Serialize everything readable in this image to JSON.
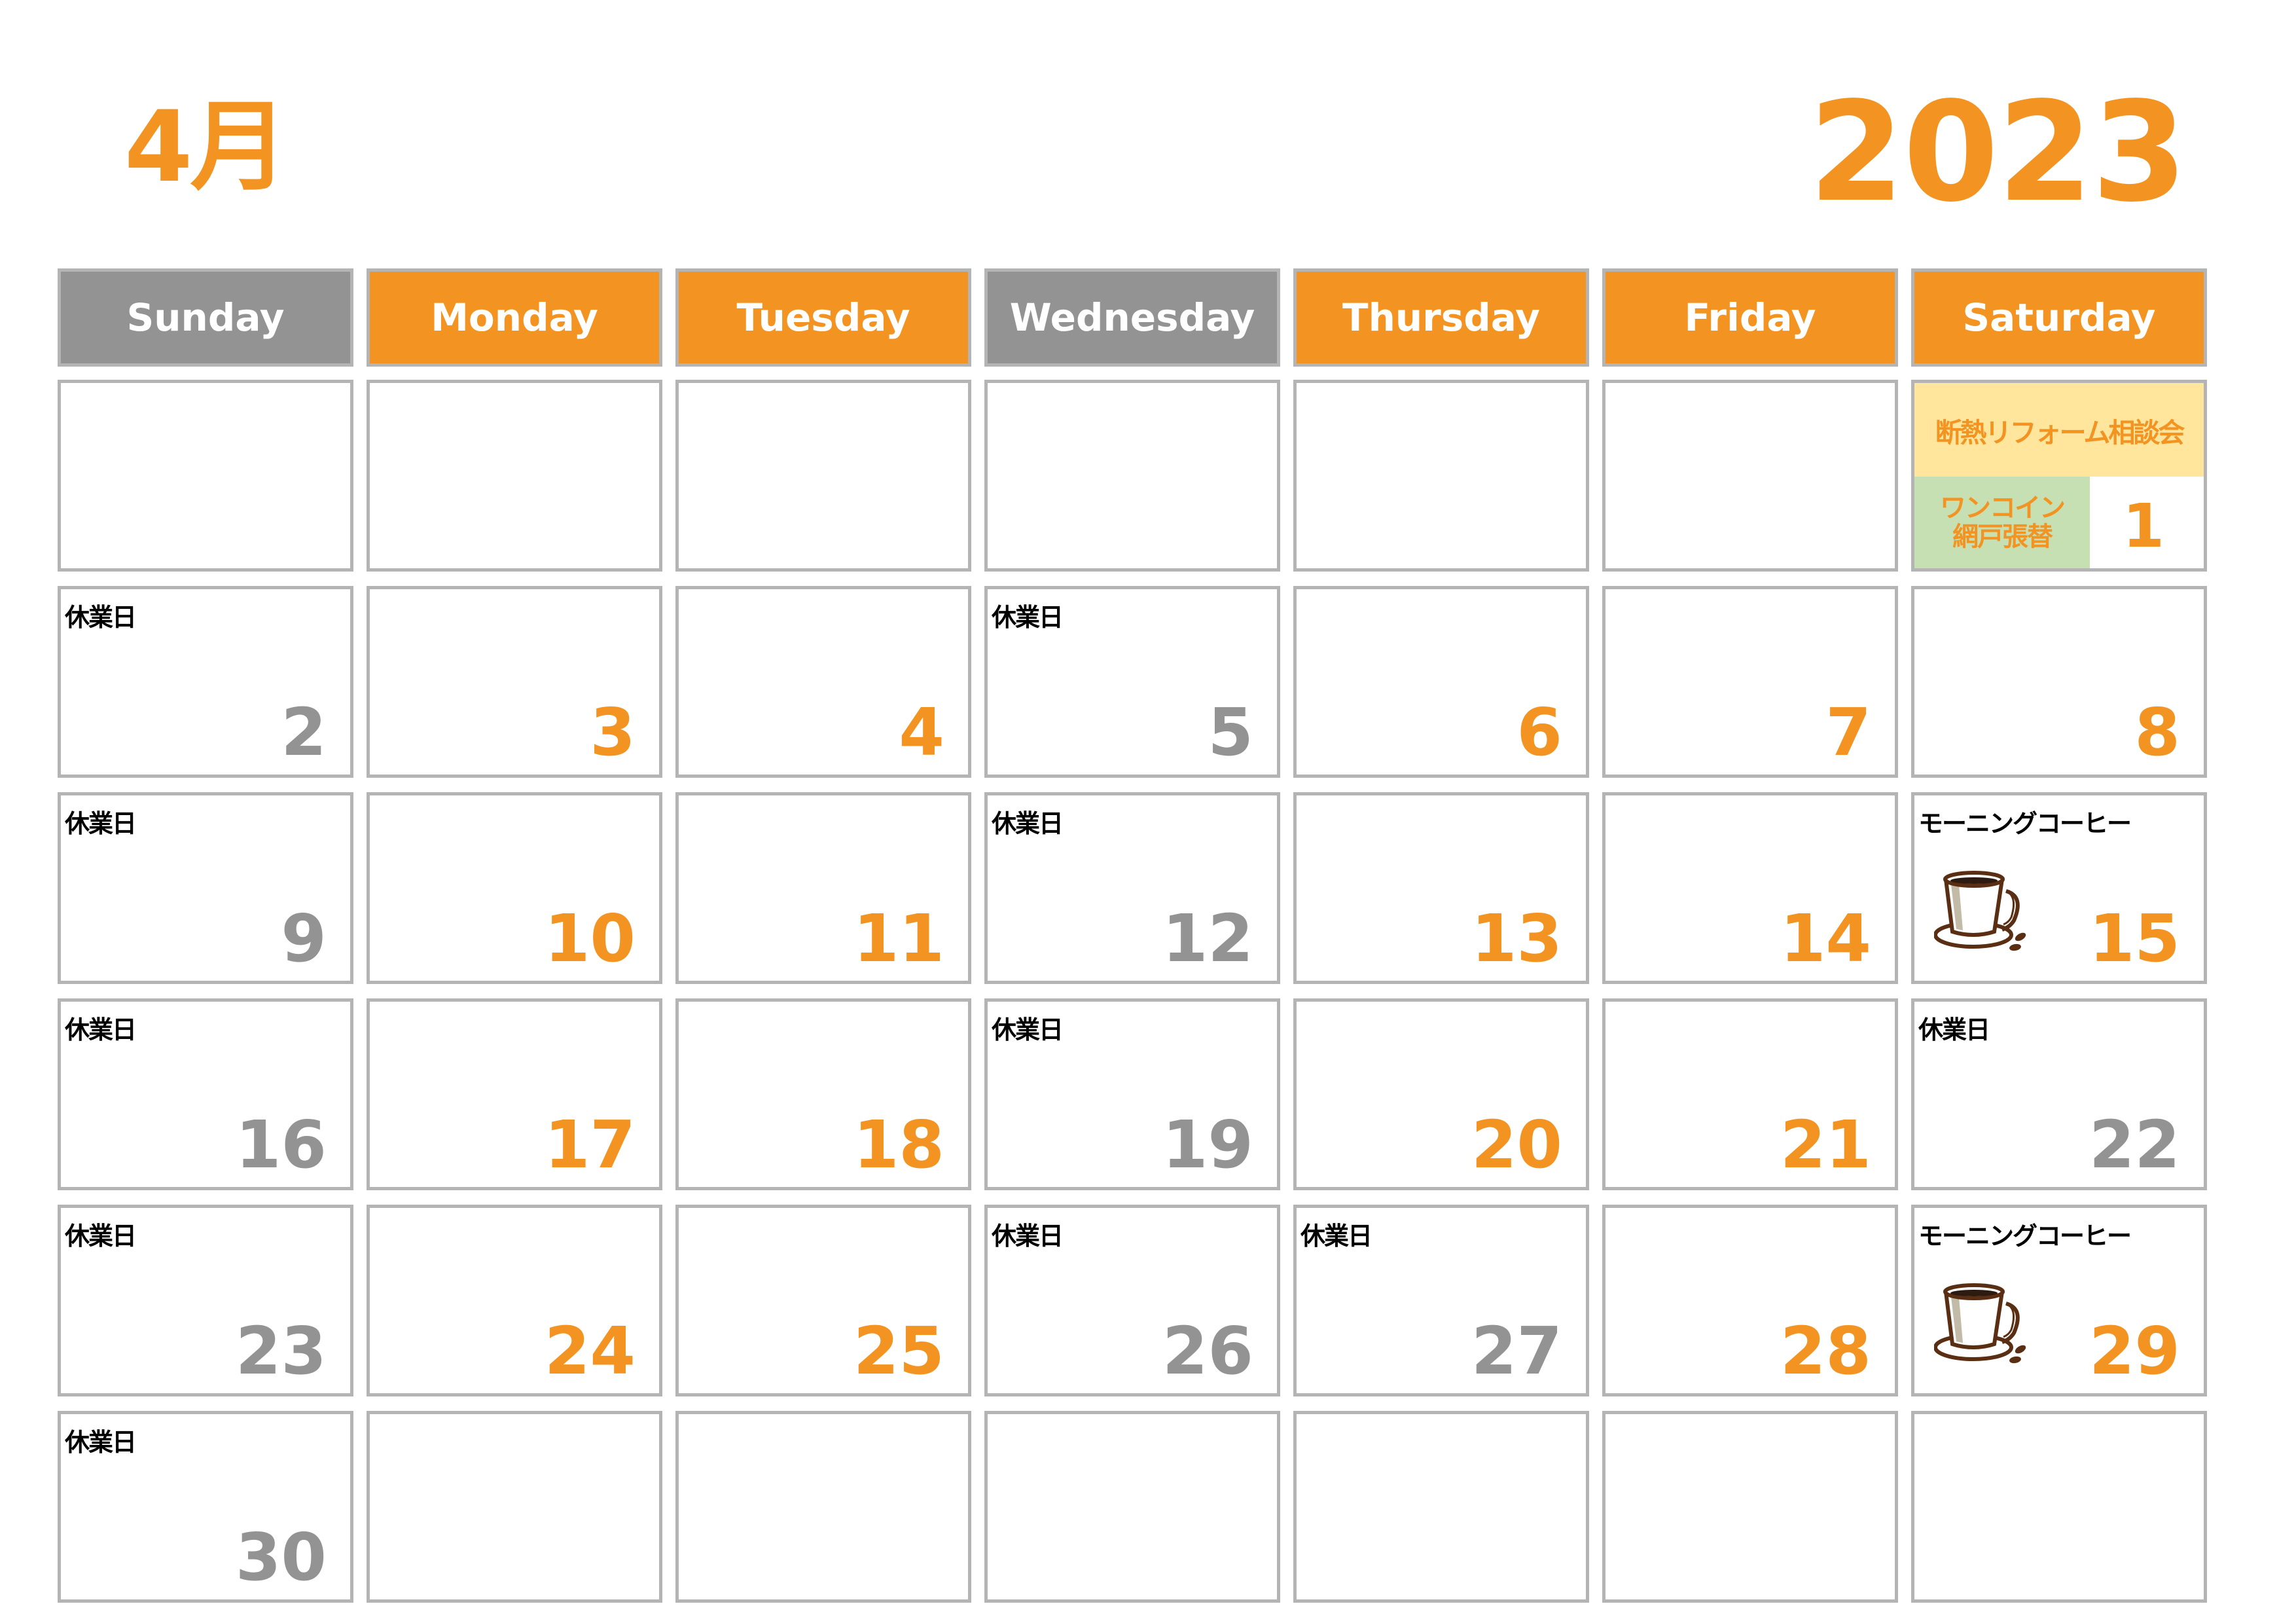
{
  "header": {
    "month": "4月",
    "year": "2023"
  },
  "colors": {
    "accent": "#F39422",
    "weekday_header": "#F39422",
    "closed_header": "#939393",
    "event_yellow": "#FFE69C",
    "event_green": "#C6E0B4"
  },
  "weekdays": [
    {
      "label": "Sunday",
      "style": "gray"
    },
    {
      "label": "Monday",
      "style": "orange"
    },
    {
      "label": "Tuesday",
      "style": "orange"
    },
    {
      "label": "Wednesday",
      "style": "gray"
    },
    {
      "label": "Thursday",
      "style": "orange"
    },
    {
      "label": "Friday",
      "style": "orange"
    },
    {
      "label": "Saturday",
      "style": "orange"
    }
  ],
  "weeks": [
    [
      {},
      {},
      {},
      {},
      {},
      {},
      {
        "day": "1",
        "style": "orange",
        "event_top": "断熱リフォーム相談会",
        "event_left_line1": "ワンコイン",
        "event_left_line2": "網戸張替"
      }
    ],
    [
      {
        "day": "2",
        "style": "gray",
        "note": "休業日"
      },
      {
        "day": "3",
        "style": "orange"
      },
      {
        "day": "4",
        "style": "orange"
      },
      {
        "day": "5",
        "style": "gray",
        "note": "休業日"
      },
      {
        "day": "6",
        "style": "orange"
      },
      {
        "day": "7",
        "style": "orange"
      },
      {
        "day": "8",
        "style": "orange"
      }
    ],
    [
      {
        "day": "9",
        "style": "gray",
        "note": "休業日"
      },
      {
        "day": "10",
        "style": "orange"
      },
      {
        "day": "11",
        "style": "orange"
      },
      {
        "day": "12",
        "style": "gray",
        "note": "休業日"
      },
      {
        "day": "13",
        "style": "orange"
      },
      {
        "day": "14",
        "style": "orange"
      },
      {
        "day": "15",
        "style": "orange",
        "note": "モーニングコーヒー",
        "icon": "coffee-cup-icon"
      }
    ],
    [
      {
        "day": "16",
        "style": "gray",
        "note": "休業日"
      },
      {
        "day": "17",
        "style": "orange"
      },
      {
        "day": "18",
        "style": "orange"
      },
      {
        "day": "19",
        "style": "gray",
        "note": "休業日"
      },
      {
        "day": "20",
        "style": "orange"
      },
      {
        "day": "21",
        "style": "orange"
      },
      {
        "day": "22",
        "style": "gray",
        "note": "休業日"
      }
    ],
    [
      {
        "day": "23",
        "style": "gray",
        "note": "休業日"
      },
      {
        "day": "24",
        "style": "orange"
      },
      {
        "day": "25",
        "style": "orange"
      },
      {
        "day": "26",
        "style": "gray",
        "note": "休業日"
      },
      {
        "day": "27",
        "style": "gray",
        "note": "休業日"
      },
      {
        "day": "28",
        "style": "orange"
      },
      {
        "day": "29",
        "style": "orange",
        "note": "モーニングコーヒー",
        "icon": "coffee-cup-icon"
      }
    ],
    [
      {
        "day": "30",
        "style": "gray",
        "note": "休業日"
      },
      {},
      {},
      {},
      {},
      {},
      {}
    ]
  ]
}
